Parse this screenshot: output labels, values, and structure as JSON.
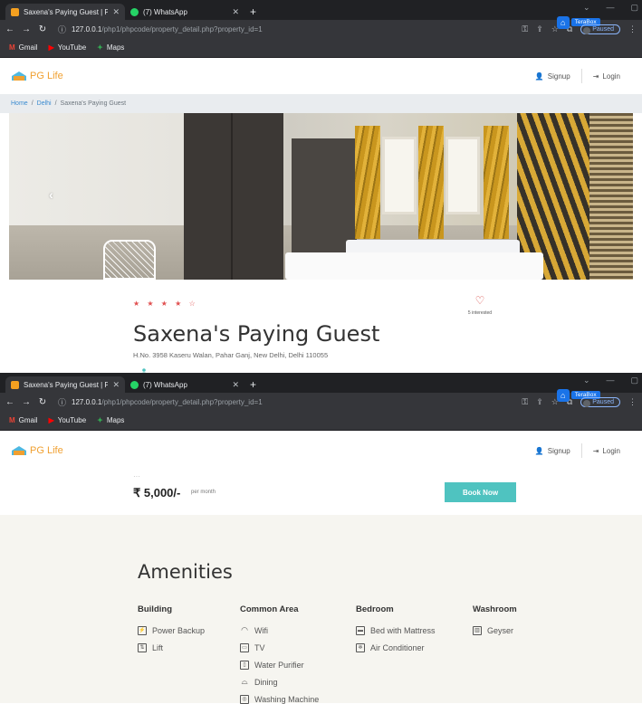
{
  "browser1": {
    "tabs": [
      {
        "title": "Saxena's Paying Guest | PG Life",
        "favicon_color": "#f4a020"
      },
      {
        "title": "(7) WhatsApp",
        "favicon_color": "#25d366"
      }
    ],
    "url_host": "127.0.0.1",
    "url_path": "/php1/phpcode/property_detail.php?property_id=1",
    "terabox_label": "TeraBox",
    "paused_label": "Paused",
    "bookmarks": [
      {
        "label": "Gmail",
        "icon": "gmail-icon"
      },
      {
        "label": "YouTube",
        "icon": "youtube-icon"
      },
      {
        "label": "Maps",
        "icon": "maps-icon"
      }
    ]
  },
  "site": {
    "logo_text": "PG Life",
    "signup_label": "Signup",
    "login_label": "Login"
  },
  "breadcrumb": {
    "home": "Home",
    "city": "Delhi",
    "current": "Saxena's Paying Guest"
  },
  "property": {
    "rating_stars": "★ ★ ★ ★ ☆",
    "rating": 4,
    "interested_count": "5 interested",
    "name": "Saxena's Paying Guest",
    "address": "H.No. 3958 Kaseru Walan, Pahar Ganj, New Delhi, Delhi 110055",
    "rent": "₹ 5,000/-",
    "rent_period": "per month",
    "book_now": "Book Now"
  },
  "browser2": {
    "tabs": [
      {
        "title": "Saxena's Paying Guest | PG Life",
        "favicon_color": "#f4a020"
      },
      {
        "title": "(7) WhatsApp",
        "favicon_color": "#25d366"
      }
    ],
    "url_host": "127.0.0.1",
    "url_path": "/php1/phpcode/property_detail.php?property_id=1",
    "terabox_label": "TeraBox",
    "paused_label": "Paused",
    "bookmarks": [
      {
        "label": "Gmail",
        "icon": "gmail-icon"
      },
      {
        "label": "YouTube",
        "icon": "youtube-icon"
      },
      {
        "label": "Maps",
        "icon": "maps-icon"
      }
    ]
  },
  "amenities": {
    "title": "Amenities",
    "building": {
      "heading": "Building",
      "items": [
        "Power Backup",
        "Lift"
      ]
    },
    "common": {
      "heading": "Common Area",
      "items": [
        "Wifi",
        "TV",
        "Water Purifier",
        "Dining",
        "Washing Machine"
      ]
    },
    "bedroom": {
      "heading": "Bedroom",
      "items": [
        "Bed with Mattress",
        "Air Conditioner"
      ]
    },
    "washroom": {
      "heading": "Washroom",
      "items": [
        "Geyser"
      ]
    }
  },
  "colors": {
    "accent": "#4fc3c0",
    "logo": "#f0a030",
    "stars": "#e05050",
    "heart": "#d9534f",
    "breadcrumb_link": "#3a8bd0"
  }
}
